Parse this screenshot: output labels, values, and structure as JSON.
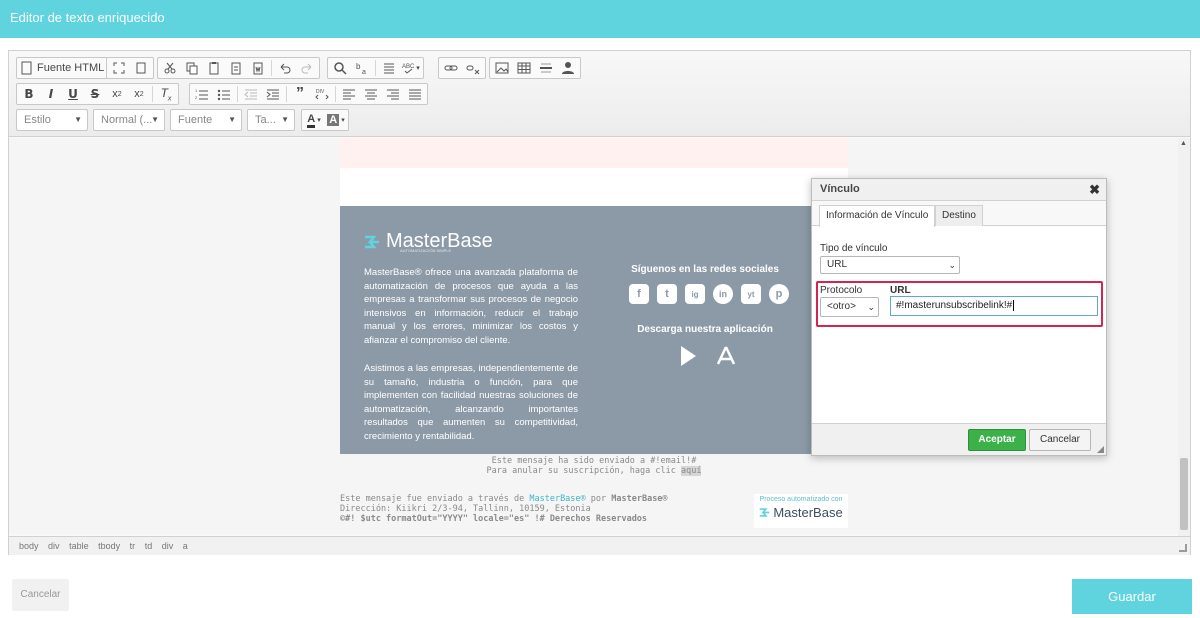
{
  "header": {
    "title": "Editor de texto enriquecido"
  },
  "toolbar": {
    "source_label": "Fuente HTML",
    "combos": {
      "style": "Estilo",
      "format": "Normal (...",
      "font": "Fuente",
      "size": "Ta..."
    }
  },
  "email": {
    "logo_text": "MasterBase",
    "logo_sub": "AUTOMATIZACIÓN SIMPLE",
    "para1": "MasterBase® ofrece una avanzada plataforma de automatización de procesos que ayuda a las empresas a transformar sus procesos de negocio intensivos en información, reducir el trabajo manual y los errores, minimizar los costos y afianzar el compromiso del cliente.",
    "para2": "Asistimos a las empresas, independientemente de su tamaño, industria o función, para que implementen con facilidad nuestras soluciones de automatización, alcanzando importantes resultados que aumenten su competitividad, crecimiento y rentabilidad.",
    "social_title": "Síguenos en las redes sociales",
    "social_icons": [
      "f",
      "t",
      "ig",
      "in",
      "yt",
      "p"
    ],
    "app_title": "Descarga nuestra aplicación",
    "sent_line1": "Este mensaje ha sido enviado a #!email!#",
    "sent_line2_prefix": "Para anular su suscripción, haga clic ",
    "sent_link": "aquí",
    "footer_prefix": "Este mensaje fue enviado a través de ",
    "footer_mb_link": "MasterBase®",
    "footer_por": " por ",
    "footer_mb_bold": "MasterBase®",
    "footer_address": "Dirección: Kiikri 2/3-94, Tallinn, 10159, Estonia",
    "footer_rights": "©#! $utc formatOut=\"YYYY\" locale=\"es\" !# Derechos Reservados",
    "footer_logo_caption": "Proceso automatizado con",
    "footer_logo_name": "MasterBase"
  },
  "pathbar": [
    "body",
    "div",
    "table",
    "tbody",
    "tr",
    "td",
    "div",
    "a"
  ],
  "dialog": {
    "title": "Vínculo",
    "close": "✖",
    "tabs": [
      "Información de Vínculo",
      "Destino"
    ],
    "link_type_label": "Tipo de vínculo",
    "link_type_value": "URL",
    "protocol_label": "Protocolo",
    "protocol_value": "<otro>",
    "url_label": "URL",
    "url_value": "#!masterunsubscribelink!#",
    "accept": "Aceptar",
    "cancel": "Cancelar"
  },
  "footer": {
    "cancel": "Cancelar",
    "save": "Guardar"
  },
  "colors": {
    "accent": "#5fd3de",
    "accept_green": "#3cb14a",
    "highlight_red": "#d4244f",
    "email_panel": "#8c9aa7"
  }
}
